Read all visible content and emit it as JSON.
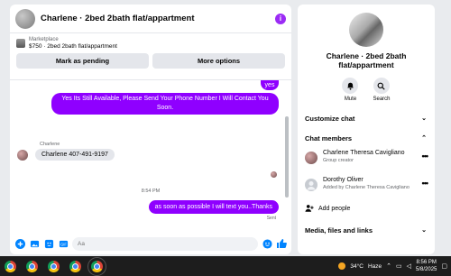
{
  "chat": {
    "title": "Charlene · 2bed 2bath flat/appartment",
    "marketplace": {
      "label": "Marketplace",
      "listing": "$750 · 2bed 2bath flat/appartment",
      "buttons": [
        "Mark as pending",
        "More options"
      ]
    },
    "messages": {
      "out_short": "yes",
      "out_long": "Yes Its Still Available, Please Send Your Phone Number I Will Contact You Soon.",
      "sender_name": "Charlene",
      "in_text": "Charlene 407-491-9197",
      "time": "8:54 PM",
      "out_thanks": "as soon as possible I will text you..Thanks",
      "status": "Sent"
    },
    "composer": {
      "placeholder": "Aa"
    }
  },
  "sidebar": {
    "name": "Charlene · 2bed 2bath flat/appartment",
    "actions": [
      "Mute",
      "Search"
    ],
    "sections": {
      "customize": "Customize chat",
      "members": "Chat members",
      "media": "Media, files and links"
    },
    "members": [
      {
        "name": "Charlene Theresa Cavigliano",
        "subtitle": "Group creator"
      },
      {
        "name": "Dorothy Oliver",
        "subtitle": "Added by Charlene Theresa Cavigliano"
      }
    ],
    "add_people": "Add people"
  },
  "taskbar": {
    "weather": {
      "temp": "34°C",
      "condition": "Haze"
    },
    "time": "8:56 PM",
    "date": "5/8/2025"
  },
  "colors": {
    "outgoing_bubble": "#8f00ff",
    "incoming_bubble": "#e4e6eb",
    "accent": "#0084ff",
    "info_button": "#9b2bf5"
  }
}
